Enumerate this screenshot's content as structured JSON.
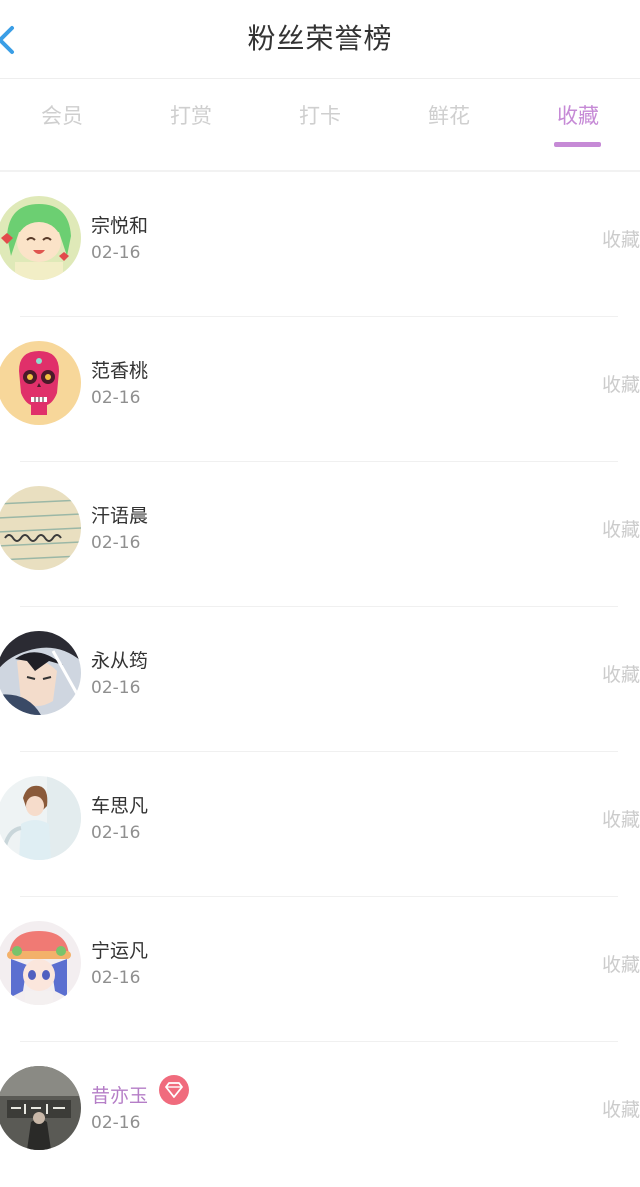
{
  "header": {
    "title": "粉丝荣誉榜",
    "back_icon": "chevron-left-icon",
    "back_color": "#3a9ee6"
  },
  "tabs": [
    {
      "label": "会员",
      "active": false
    },
    {
      "label": "打赏",
      "active": false
    },
    {
      "label": "打卡",
      "active": false
    },
    {
      "label": "鲜花",
      "active": false
    },
    {
      "label": "收藏",
      "active": true
    }
  ],
  "colors": {
    "accent": "#c68ad6",
    "inactive_tab": "#cfcfcf",
    "vip_badge": "#f06b7d"
  },
  "fans": [
    {
      "name": "宗悦和",
      "date": "02-16",
      "action": "收藏",
      "avatar": "anime-girl-green-hair-avatar"
    },
    {
      "name": "范香桃",
      "date": "02-16",
      "action": "收藏",
      "avatar": "pink-skull-avatar"
    },
    {
      "name": "汗语晨",
      "date": "02-16",
      "action": "收藏",
      "avatar": "handwriting-paper-avatar"
    },
    {
      "name": "永从筠",
      "date": "02-16",
      "action": "收藏",
      "avatar": "anime-boy-avatar"
    },
    {
      "name": "车思凡",
      "date": "02-16",
      "action": "收藏",
      "avatar": "girl-photo-avatar"
    },
    {
      "name": "宁运凡",
      "date": "02-16",
      "action": "收藏",
      "avatar": "anime-girl-hat-avatar"
    },
    {
      "name": "昔亦玉",
      "date": "02-16",
      "action": "收藏",
      "avatar": "calligraphy-avatar",
      "vip": true,
      "badge_icon": "diamond-icon"
    }
  ]
}
